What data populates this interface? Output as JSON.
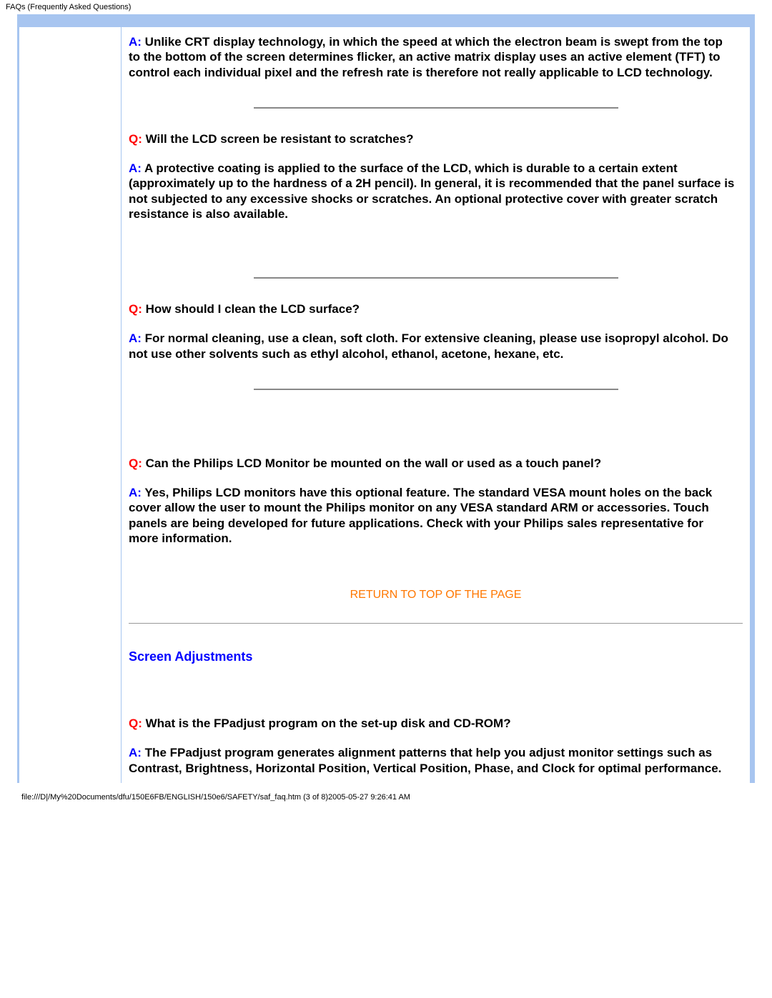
{
  "header": {
    "title": "FAQs (Frequently Asked Questions)"
  },
  "faq": {
    "a1": {
      "prefix": "A:",
      "text": " Unlike CRT display technology, in which the speed at which the electron beam is swept from the top to the bottom of the screen determines flicker, an active matrix display uses an active element (TFT) to control each individual pixel and the refresh rate is therefore not really applicable to LCD technology."
    },
    "q2": {
      "prefix": "Q:",
      "text": " Will the LCD screen be resistant to scratches?"
    },
    "a2": {
      "prefix": "A:",
      "text": " A protective coating is applied to the surface of the LCD, which is durable to a certain extent (approximately up to the hardness of a 2H pencil). In general, it is recommended that the panel surface is not subjected to any excessive shocks or scratches. An optional protective cover with greater scratch resistance is also available."
    },
    "q3": {
      "prefix": "Q:",
      "text": " How should I clean the LCD surface?"
    },
    "a3": {
      "prefix": "A:",
      "text": " For normal cleaning, use a clean, soft cloth. For extensive cleaning, please use isopropyl alcohol. Do not use other solvents such as ethyl alcohol, ethanol, acetone, hexane, etc."
    },
    "q4": {
      "prefix": "Q:",
      "text": " Can the Philips LCD Monitor be mounted on the wall or used as a touch panel?"
    },
    "a4": {
      "prefix": "A:",
      "text": " Yes, Philips LCD monitors have this optional feature. The standard VESA mount holes on the back cover allow the user to mount the Philips monitor on any VESA standard ARM or accessories. Touch panels are being developed for future applications. Check with your Philips sales representative for more information."
    },
    "return_link": "RETURN TO TOP OF THE PAGE",
    "section2": "Screen Adjustments",
    "q5": {
      "prefix": "Q:",
      "text": " What is the FPadjust program on the set-up disk and CD-ROM?"
    },
    "a5": {
      "prefix": "A:",
      "text": " The FPadjust program generates alignment patterns that help you adjust monitor settings such as Contrast, Brightness, Horizontal Position, Vertical Position, Phase, and Clock for optimal performance."
    }
  },
  "footer": {
    "path": "file:///D|/My%20Documents/dfu/150E6FB/ENGLISH/150e6/SAFETY/saf_faq.htm (3 of 8)2005-05-27 9:26:41 AM"
  }
}
